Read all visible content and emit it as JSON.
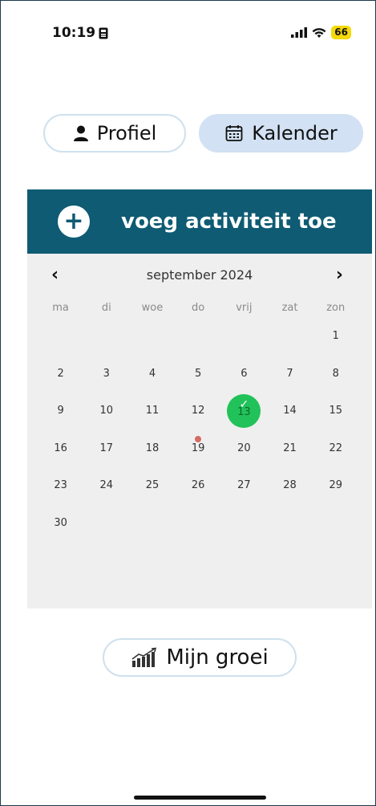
{
  "status": {
    "time": "10:19",
    "battery": "66"
  },
  "tabs": {
    "profiel": "Profiel",
    "kalender": "Kalender"
  },
  "calendar": {
    "add_label": "voeg activiteit toe",
    "month": "september 2024",
    "weekdays": [
      "ma",
      "di",
      "woe",
      "do",
      "vrij",
      "zat",
      "zon"
    ],
    "days": [
      "",
      "",
      "",
      "",
      "",
      "",
      "1",
      "2",
      "3",
      "4",
      "5",
      "6",
      "7",
      "8",
      "9",
      "10",
      "11",
      "12",
      "13",
      "14",
      "15",
      "16",
      "17",
      "18",
      "19",
      "20",
      "21",
      "22",
      "23",
      "24",
      "25",
      "26",
      "27",
      "28",
      "29",
      "30"
    ],
    "completed_day": "13",
    "event_day": "19",
    "colors": {
      "header": "#0e5b73",
      "completed": "#21c25a",
      "event_dot": "#d66a63"
    }
  },
  "growth_button": "Mijn groei"
}
